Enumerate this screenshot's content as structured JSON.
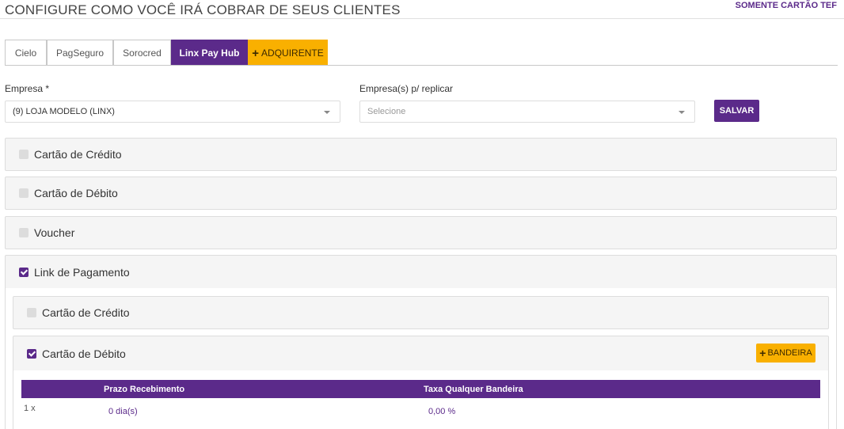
{
  "header": {
    "title": "CONFIGURE COMO VOCÊ IRÁ COBRAR DE SEUS CLIENTES",
    "tef_link": "SOMENTE CARTÃO TEF"
  },
  "tabs": [
    {
      "label": "Cielo",
      "active": false
    },
    {
      "label": "PagSeguro",
      "active": false
    },
    {
      "label": "Sorocred",
      "active": false
    },
    {
      "label": "Linx Pay Hub",
      "active": true
    },
    {
      "label": "ADQUIRENTE",
      "icon": "plus-icon"
    }
  ],
  "form": {
    "empresa_label": "Empresa *",
    "empresa_value": "(9) LOJA MODELO (LINX)",
    "replicar_label": "Empresa(s) p/ replicar",
    "replicar_placeholder": "Selecione",
    "save_label": "SALVAR"
  },
  "panels": [
    {
      "label": "Cartão de Crédito",
      "checked": false
    },
    {
      "label": "Cartão de Débito",
      "checked": false
    },
    {
      "label": "Voucher",
      "checked": false
    },
    {
      "label": "Link de Pagamento",
      "checked": true
    }
  ],
  "link_pagamento": {
    "subpanels": [
      {
        "label": "Cartão de Crédito",
        "checked": false
      },
      {
        "label": "Cartão de Débito",
        "checked": true
      }
    ],
    "bandeira_label": "BANDEIRA",
    "table": {
      "headers": [
        "Prazo Recebimento",
        "Taxa Qualquer Bandeira"
      ],
      "rows": [
        {
          "installments": "1 x",
          "prazo": "0 dia(s)",
          "taxa": "0,00 %"
        }
      ]
    }
  },
  "colors": {
    "primary": "#5b2a8a",
    "accent": "#f9b000",
    "panel_bg": "#f5f5f5"
  }
}
